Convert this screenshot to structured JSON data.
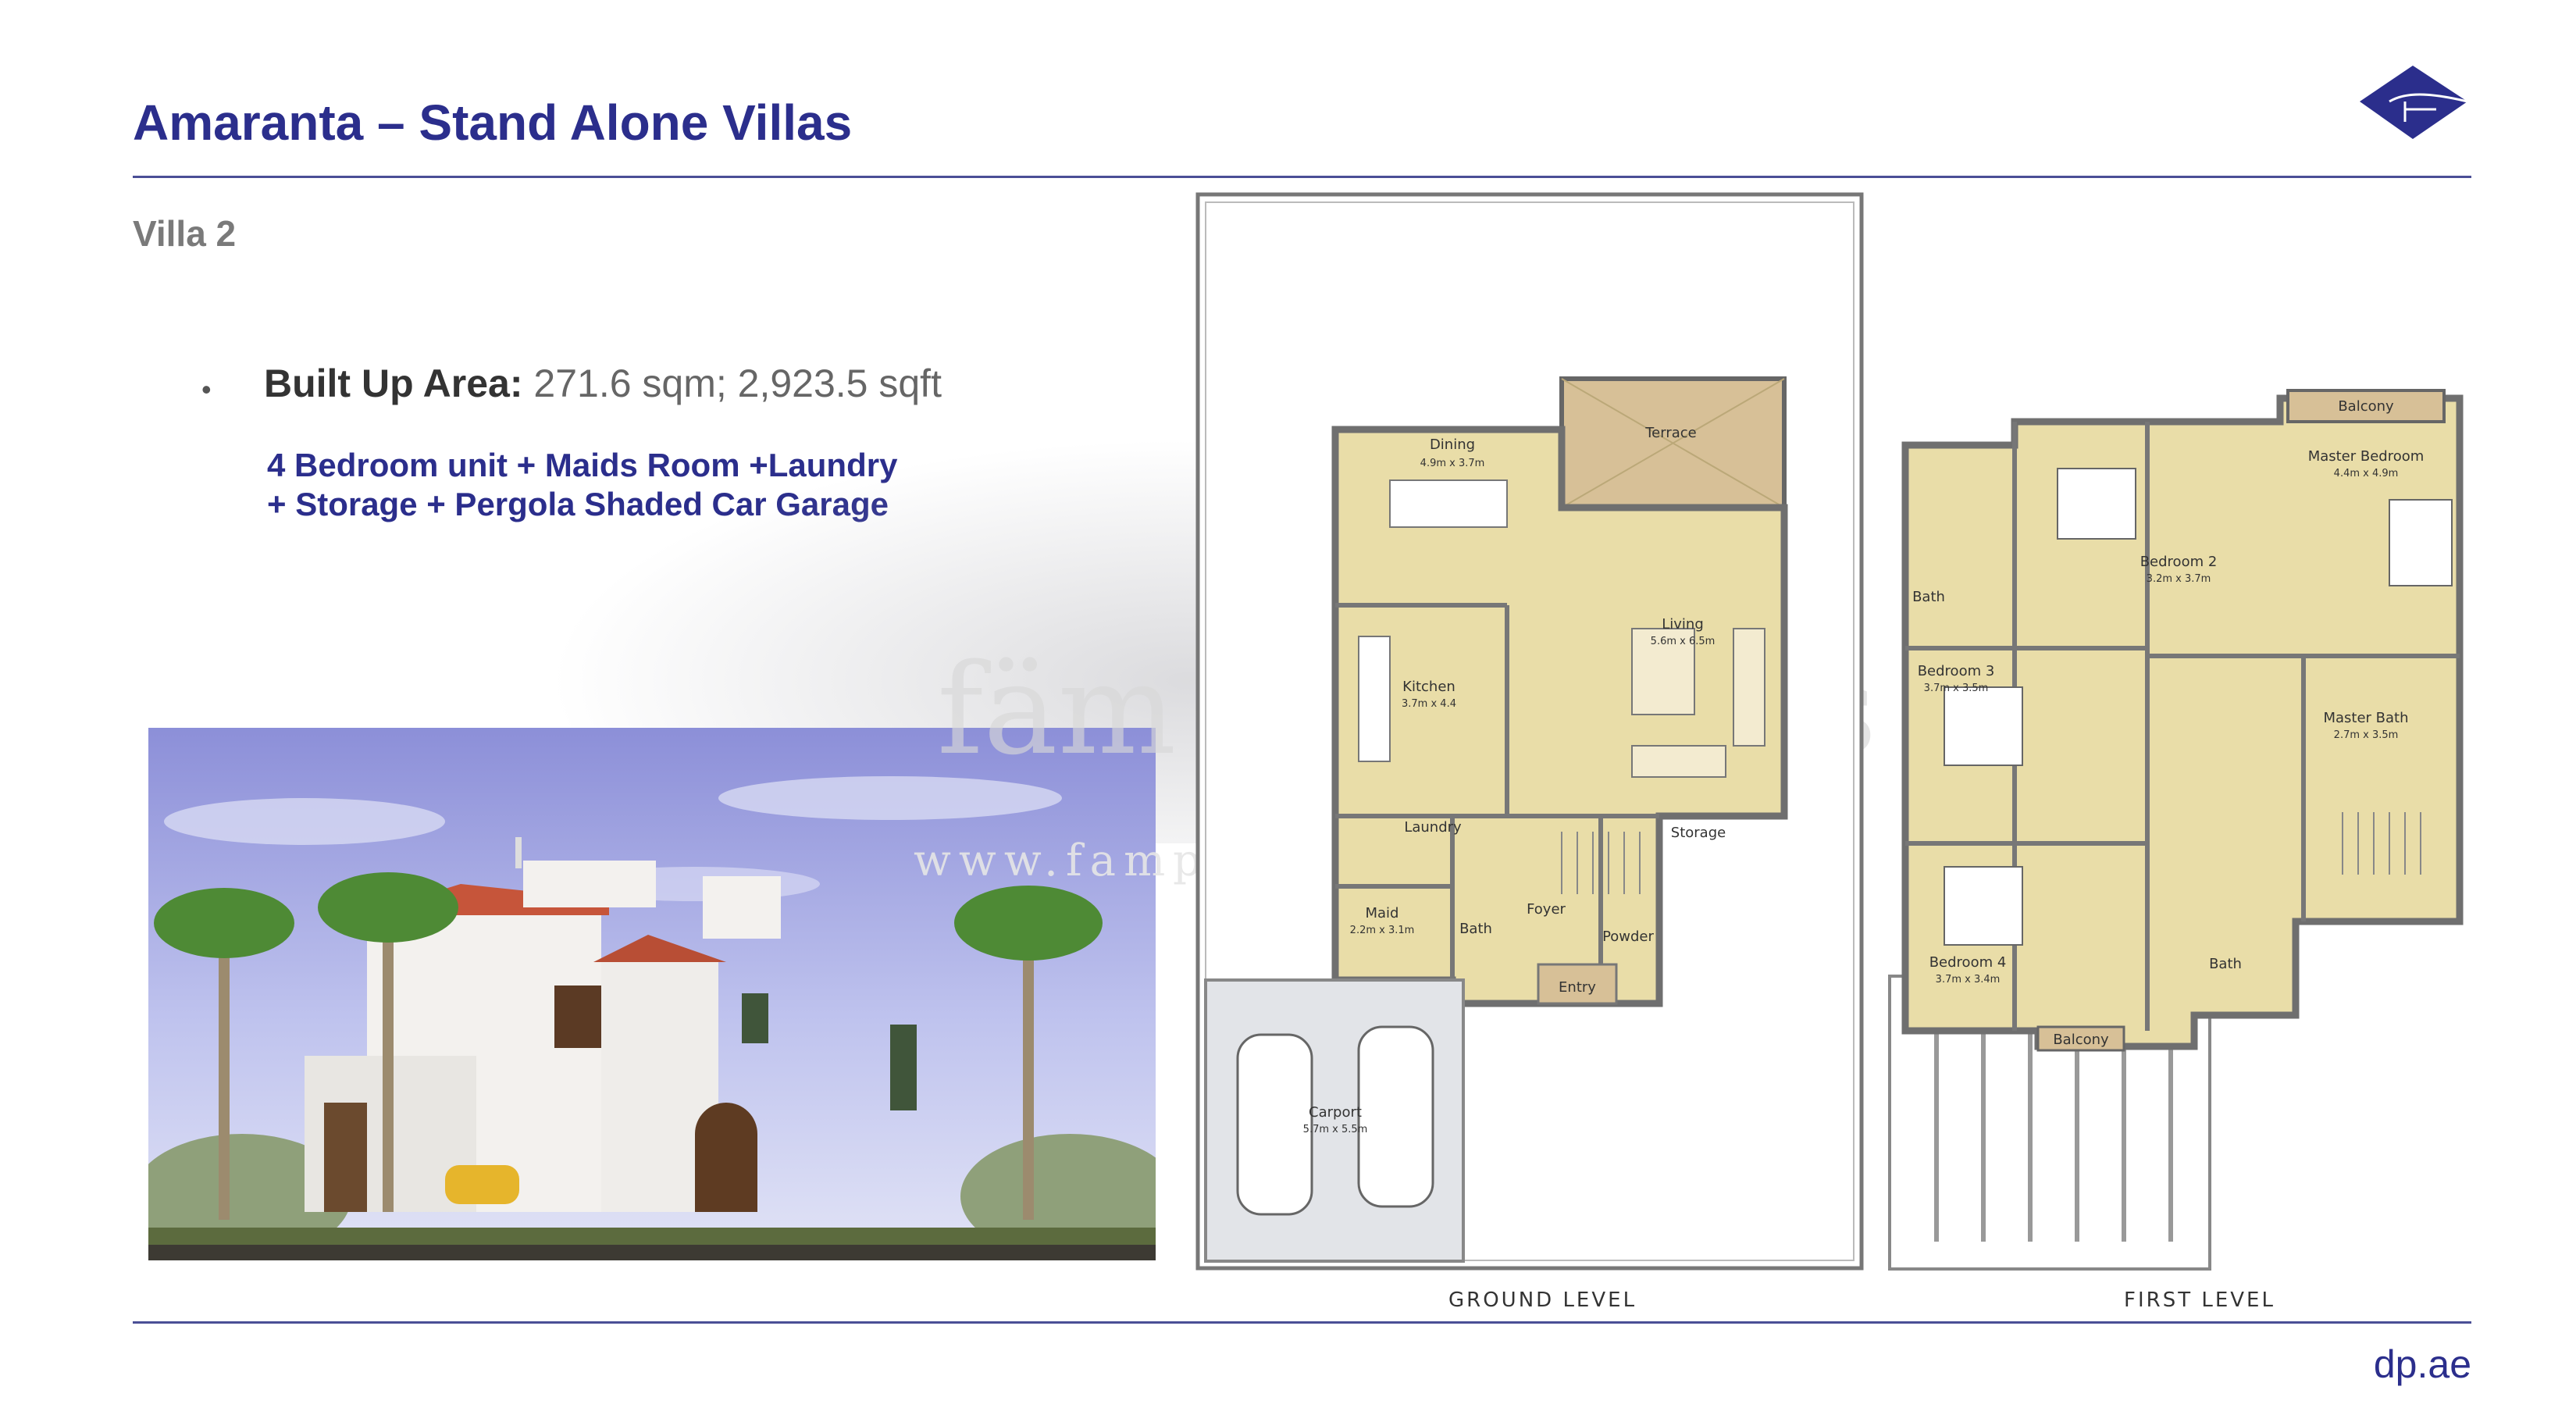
{
  "header": {
    "title": "Amaranta – Stand Alone Villas"
  },
  "section": {
    "subtitle": "Villa 2"
  },
  "details": {
    "area_label": "Built Up Area:",
    "area_value": "271.6 sqm; 2,923.5 sqft",
    "description_line1": "4 Bedroom unit + Maids Room +Laundry",
    "description_line2": "+ Storage + Pergola Shaded Car Garage"
  },
  "watermark": {
    "brand": "fäm Properties",
    "url": "www.fampropertties.com"
  },
  "ground_level": {
    "label": "GROUND LEVEL",
    "rooms": [
      {
        "name": "Dining",
        "dims": "4.9m x 3.7m"
      },
      {
        "name": "Terrace",
        "dims": ""
      },
      {
        "name": "Living",
        "dims": "5.6m x 6.5m"
      },
      {
        "name": "Kitchen",
        "dims": "3.7m x 4.4"
      },
      {
        "name": "Laundry",
        "dims": ""
      },
      {
        "name": "Storage",
        "dims": ""
      },
      {
        "name": "Maid",
        "dims": "2.2m x 3.1m"
      },
      {
        "name": "Bath",
        "dims": ""
      },
      {
        "name": "Foyer",
        "dims": ""
      },
      {
        "name": "Powder",
        "dims": ""
      },
      {
        "name": "Entry",
        "dims": ""
      },
      {
        "name": "Carport",
        "dims": "5.7m x 5.5m"
      }
    ]
  },
  "first_level": {
    "label": "FIRST LEVEL",
    "rooms": [
      {
        "name": "Balcony",
        "dims": ""
      },
      {
        "name": "Master Bedroom",
        "dims": "4.4m x 4.9m"
      },
      {
        "name": "Bedroom 2",
        "dims": "3.2m x 3.7m"
      },
      {
        "name": "Bath",
        "dims": ""
      },
      {
        "name": "Bedroom 3",
        "dims": "3.7m x 3.5m"
      },
      {
        "name": "Master Bath",
        "dims": "2.7m x 3.5m"
      },
      {
        "name": "Bedroom 4",
        "dims": "3.7m x 3.4m"
      },
      {
        "name": "Bath",
        "dims": ""
      },
      {
        "name": "Balcony",
        "dims": ""
      }
    ]
  },
  "footer": {
    "url": "dp.ae"
  },
  "colors": {
    "brand": "#2B2E8C",
    "plan_fill": "#E9DDA8",
    "wall": "#8B8B8B"
  }
}
